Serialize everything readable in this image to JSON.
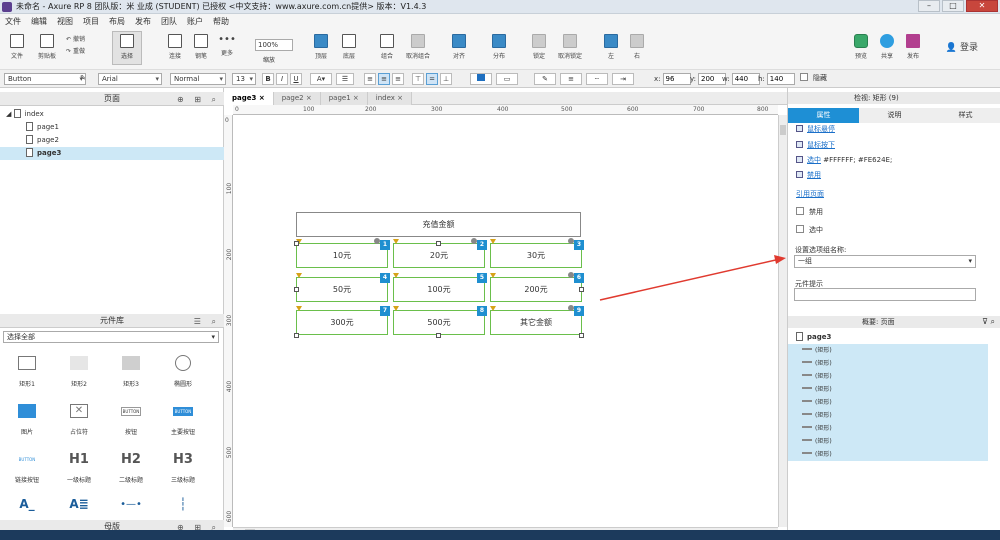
{
  "window": {
    "title": "未命名 - Axure RP 8 团队版：米 业成 (STUDENT) 已授权     <中文支持：www.axure.com.cn提供> 版本：V1.4.3"
  },
  "menu": [
    "文件",
    "编辑",
    "视图",
    "项目",
    "布局",
    "发布",
    "团队",
    "账户",
    "帮助"
  ],
  "toolbar": {
    "file": "文件",
    "clipboard": "剪贴板",
    "undo": "撤销",
    "redo": "重做",
    "select": "选择",
    "connect": "连接",
    "pen": "钢笔",
    "more": "更多",
    "zoom_value": "100%",
    "zoom_label": "缩放",
    "top": "顶层",
    "bottom": "底层",
    "group": "组合",
    "ungroup": "取消组合",
    "align": "对齐",
    "distribute": "分布",
    "lock": "锁定",
    "unlock": "取消锁定",
    "left": "左",
    "right": "右",
    "preview": "预览",
    "share": "共享",
    "publish": "发布",
    "login": "登录"
  },
  "formatbar": {
    "widget_style": "Button",
    "font": "Arial",
    "weight": "Normal",
    "size": "13",
    "x_label": "x:",
    "x": "96",
    "y_label": "y:",
    "y": "200",
    "w_label": "w:",
    "w": "440",
    "h_label": "h:",
    "h": "140",
    "hidden": "隐藏"
  },
  "pages_panel": {
    "title": "页面",
    "root": "index",
    "pages": [
      "page1",
      "page2",
      "page3"
    ],
    "selected": "page3"
  },
  "library": {
    "title": "元件库",
    "filter": "选择全部",
    "widgets": [
      "矩形1",
      "矩形2",
      "矩形3",
      "椭圆形",
      "图片",
      "占位符",
      "按钮",
      "主要按钮",
      "链接按钮",
      "一级标题",
      "二级标题",
      "三级标题"
    ],
    "button_text": "BUTTON",
    "h1": "H1",
    "h2": "H2",
    "h3": "H3"
  },
  "masters": {
    "title": "母版"
  },
  "tabs": [
    "page3",
    "page2",
    "page1",
    "index"
  ],
  "ruler_h": [
    "0",
    "100",
    "200",
    "300",
    "400",
    "500",
    "600",
    "700",
    "800"
  ],
  "ruler_v": [
    "0",
    "100",
    "200",
    "300",
    "400",
    "500",
    "600"
  ],
  "canvas": {
    "header": "充值金额",
    "options": [
      "10元",
      "20元",
      "30元",
      "50元",
      "100元",
      "200元",
      "300元",
      "500元",
      "其它金额"
    ],
    "badges": [
      "1",
      "2",
      "3",
      "4",
      "5",
      "6",
      "7",
      "8",
      "9"
    ]
  },
  "inspector": {
    "title": "检视: 矩形 (9)",
    "tabs": [
      "属性",
      "说明",
      "样式"
    ],
    "mouse_over": "鼠标悬停",
    "mouse_down": "鼠标按下",
    "selected": "选中",
    "selected_value": "#FFFFFF; #FE624E;",
    "disabled_link": "禁用",
    "ref_page": "引用页面",
    "disabled": "禁用",
    "checked": "选中",
    "group_label": "设置选项组名称:",
    "group_value": "一组",
    "tooltip_label": "元件提示"
  },
  "outline": {
    "title": "概要: 页面",
    "root": "page3",
    "items": [
      "(矩形)",
      "(矩形)",
      "(矩形)",
      "(矩形)",
      "(矩形)",
      "(矩形)",
      "(矩形)",
      "(矩形)",
      "(矩形)"
    ]
  },
  "colors": {
    "accent": "#1e8fd5",
    "selection": "#6abf4b",
    "arrow": "#e03a2f"
  }
}
